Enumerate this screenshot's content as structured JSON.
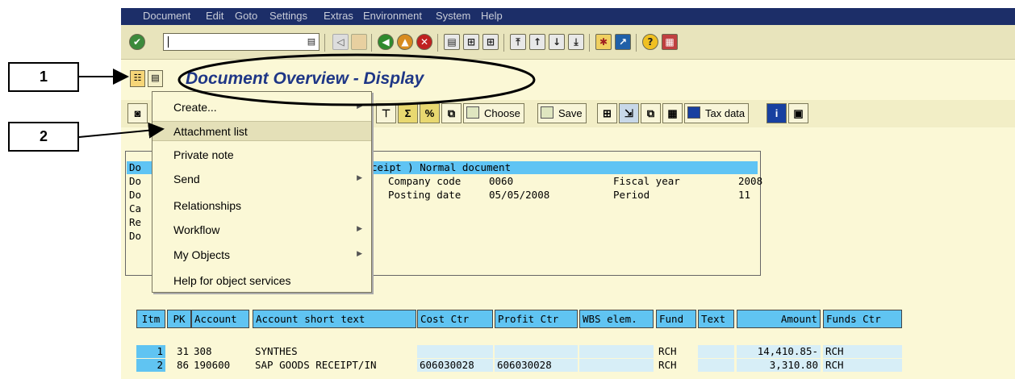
{
  "menu": {
    "document": "Document",
    "edit": "Edit",
    "goto": "Goto",
    "settings": "Settings",
    "extras": "Extras",
    "environment": "Environment",
    "system": "System",
    "help": "Help"
  },
  "title": "Document Overview - Display",
  "callouts": [
    "1",
    "2"
  ],
  "app_toolbar": {
    "choose": "Choose",
    "save": "Save",
    "tax_data": "Tax data"
  },
  "dropdown": [
    {
      "label": "Create...",
      "submenu": true
    },
    {
      "label": "Attachment list",
      "submenu": false
    },
    {
      "label": "Private note",
      "submenu": false
    },
    {
      "label": "Send",
      "submenu": true
    },
    {
      "label": "Relationships",
      "submenu": false
    },
    {
      "label": "Workflow",
      "submenu": true
    },
    {
      "label": "My Objects",
      "submenu": true
    },
    {
      "label": "Help for object services",
      "submenu": false
    }
  ],
  "header": {
    "doc_type_visible": "ceipt ) Normal document",
    "row_prefixes": [
      "Do",
      "Do",
      "Do",
      "Ca",
      "Re",
      "Do"
    ],
    "company_code_label": "Company code",
    "company_code": "0060",
    "fiscal_year_label": "Fiscal year",
    "fiscal_year": "2008",
    "posting_date_label": "Posting date",
    "posting_date": "05/05/2008",
    "period_label": "Period",
    "period": "11"
  },
  "table": {
    "columns": [
      "Itm",
      "PK",
      "Account",
      "Account short text",
      "Cost Ctr",
      "Profit Ctr",
      "WBS elem.",
      "Fund",
      "Text",
      "Amount",
      "Funds Ctr"
    ],
    "rows": [
      [
        "1",
        "31",
        "308",
        "SYNTHES",
        "",
        "",
        "",
        "RCH",
        "",
        "14,410.85-",
        "RCH"
      ],
      [
        "2",
        "86",
        "190600",
        "SAP GOODS RECEIPT/IN",
        "606030028",
        "606030028",
        "",
        "RCH",
        "",
        "3,310.80",
        "RCH"
      ]
    ]
  },
  "colors": {
    "menubar": "#1c2e68",
    "title": "#1e3686",
    "highlight": "#5fc4f4",
    "background": "#fbf8d6"
  }
}
